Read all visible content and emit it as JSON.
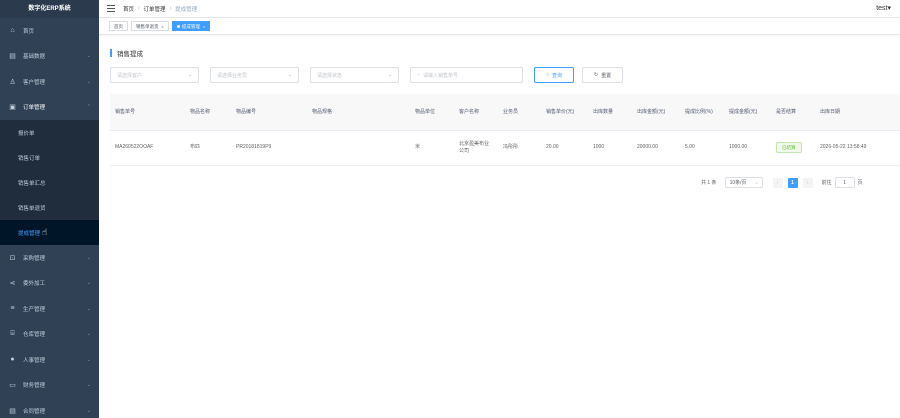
{
  "app": {
    "title": "数字化ERP系统"
  },
  "sidebar": {
    "items": [
      {
        "label": "首页",
        "icon": "home-icon"
      },
      {
        "label": "基础数据",
        "icon": "document-icon"
      },
      {
        "label": "客户管理",
        "icon": "user-icon"
      },
      {
        "label": "订单管理",
        "icon": "order-icon"
      },
      {
        "label": "采购管理",
        "icon": "cart-icon"
      },
      {
        "label": "委外加工",
        "icon": "share-icon"
      },
      {
        "label": "生产管理",
        "icon": "list-icon"
      },
      {
        "label": "仓库管理",
        "icon": "warehouse-icon"
      },
      {
        "label": "人事管理",
        "icon": "person-icon"
      },
      {
        "label": "财务管理",
        "icon": "folder-icon"
      },
      {
        "label": "合同管理",
        "icon": "contract-icon"
      }
    ],
    "order_sub": [
      {
        "label": "报价单"
      },
      {
        "label": "销售订单"
      },
      {
        "label": "销售单汇总"
      },
      {
        "label": "销售单退货"
      },
      {
        "label": "提成管理"
      }
    ]
  },
  "header": {
    "breadcrumb": [
      "首页",
      "订单管理",
      "提成管理"
    ],
    "user": "test"
  },
  "tags": [
    {
      "label": "首页"
    },
    {
      "label": "销售单退货"
    },
    {
      "label": "提成管理"
    }
  ],
  "main": {
    "title": "销售提成",
    "filters": {
      "customer_placeholder": "请选择客户",
      "salesman_placeholder": "请选择业务员",
      "status_placeholder": "请选择状态",
      "order_no_placeholder": "请输入销售单号",
      "search_label": "查询",
      "reset_label": "重置"
    },
    "table": {
      "headers": [
        "销售单号",
        "物品名称",
        "物品编号",
        "物品规格",
        "物品单位",
        "客户名称",
        "业务员",
        "销售单价(元)",
        "出库数量",
        "出库金额(元)",
        "提成比例(%)",
        "提成金额(元)",
        "是否结算",
        "出库日期"
      ],
      "rows": [
        [
          "MA260522OOAF",
          "布匹",
          "PR20181819P9",
          "",
          "米",
          "北京盈美布业公司",
          "冯彤彤",
          "20.00",
          "1000",
          "20000.00",
          "5.00",
          "1000.00",
          "已结算",
          "2026-05-22 13:58:49"
        ]
      ]
    },
    "pagination": {
      "total": "共 1 条",
      "page_size": "10条/页",
      "current": "1",
      "goto_prefix": "前往",
      "goto_value": "1",
      "goto_suffix": "页"
    }
  },
  "colors": {
    "sidebar_bg": "#304156",
    "accent": "#409eff",
    "success": "#67c23a"
  }
}
